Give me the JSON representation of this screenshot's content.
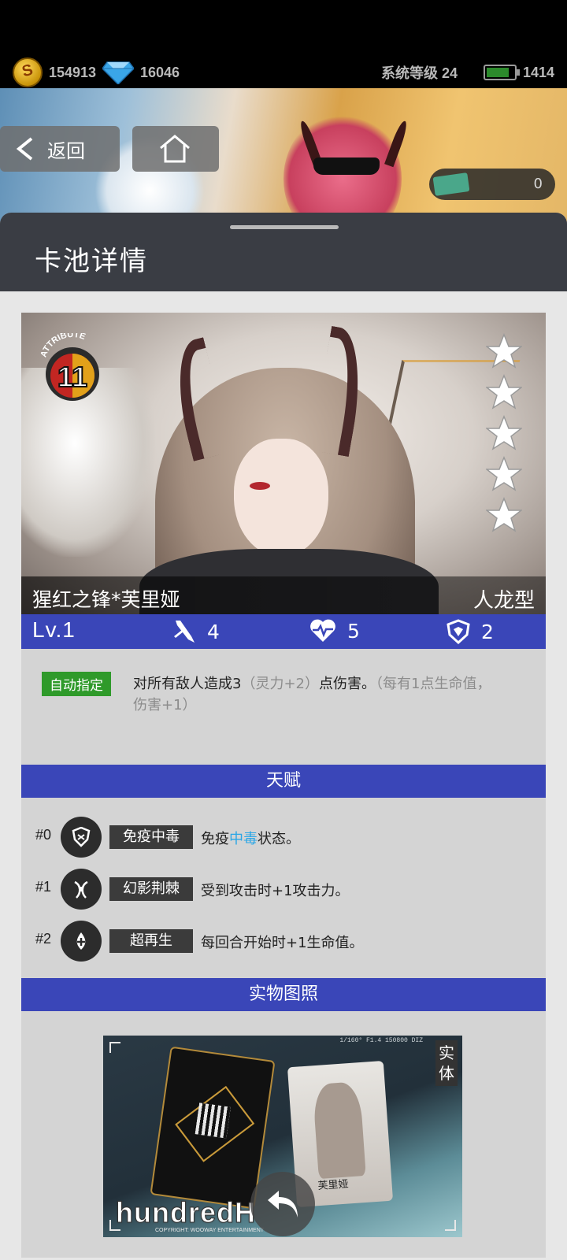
{
  "status_bar": {
    "coins": "154913",
    "gems": "16046",
    "system_level": "系统等级 24",
    "energy": "1414",
    "coin_icon": "gold-coin-icon",
    "gem_icon": "diamond-icon",
    "energy_icon": "battery-icon"
  },
  "nav": {
    "back_label": "返回",
    "home_icon": "home-icon",
    "ticket_count": "0"
  },
  "sheet": {
    "title": "卡池详情"
  },
  "card": {
    "attribute_label": "ATTRIBUTE",
    "attribute_value": "11",
    "stars": 5,
    "name": "猩红之锋*芙里娅",
    "type": "人龙型",
    "level": "Lv.1",
    "attack": "4",
    "health": "5",
    "defense": "2",
    "skill": {
      "tag": "自动指定",
      "text_main": "对所有敌人造成3",
      "text_bonus": "（灵力+2）",
      "text_after": "点伤害。",
      "text_note": "（每有1点生命值，伤害+1）"
    }
  },
  "talents": {
    "header": "天赋",
    "items": [
      {
        "index": "#0",
        "name": "免疫中毒",
        "desc_before": "免疫",
        "desc_highlight": "中毒",
        "desc_after": "状态。",
        "icon": "shield-icon"
      },
      {
        "index": "#1",
        "name": "幻影荆棘",
        "desc_before": "受到攻击时+1攻击力。",
        "desc_highlight": "",
        "desc_after": "",
        "icon": "thorn-icon"
      },
      {
        "index": "#2",
        "name": "超再生",
        "desc_before": "每回合开始时+1生命值。",
        "desc_highlight": "",
        "desc_after": "",
        "icon": "regen-icon"
      }
    ]
  },
  "photo_section": {
    "header": "实物图照",
    "badge": "实体",
    "specs": "1/160°  F1.4  150800  DIZ",
    "brand": "hundredH",
    "copyright": "COPYRIGHT: WOOWAY ENTERTAINMENT",
    "card_caption": "芙里娅"
  },
  "colors": {
    "accent_blue": "#3a46b8",
    "skill_green": "#2f9a2a",
    "highlight_blue": "#2aa6e6"
  }
}
